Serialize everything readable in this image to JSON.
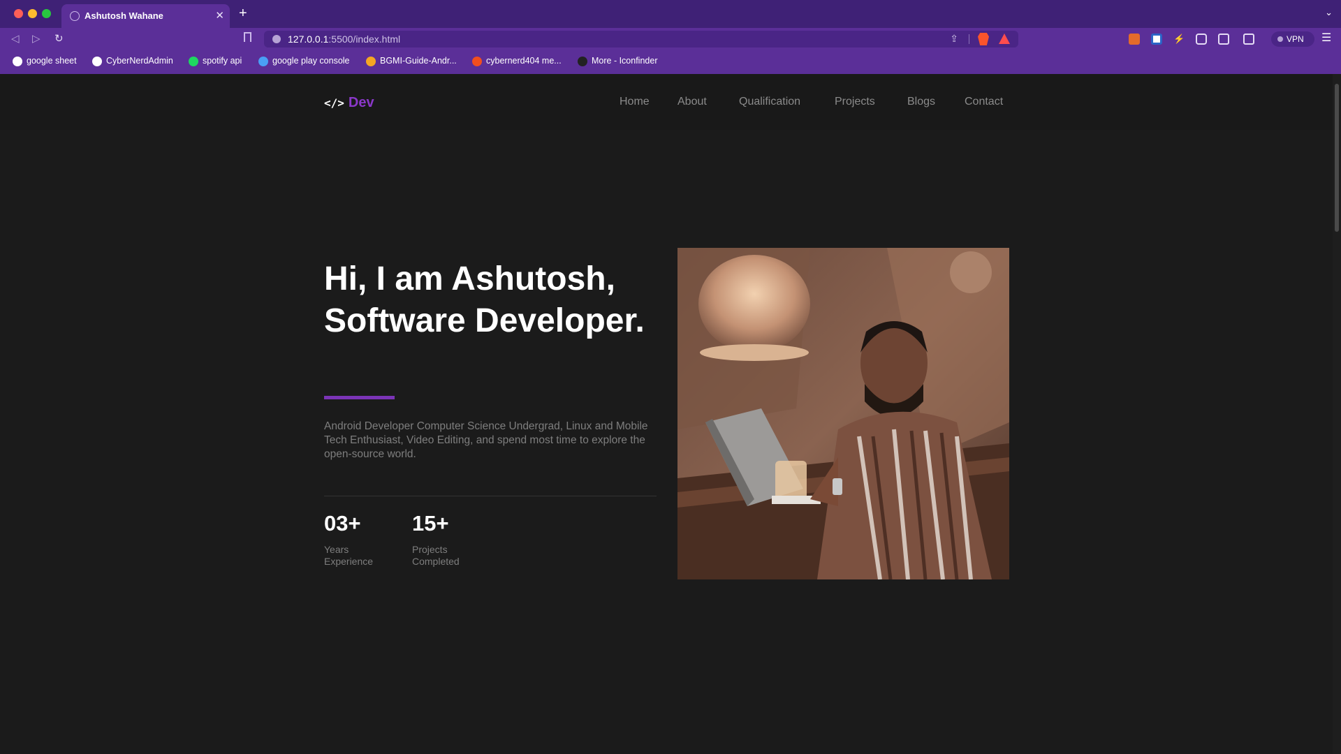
{
  "browser": {
    "tab_title": "Ashutosh Wahane",
    "tab_close": "✕",
    "new_tab": "+",
    "tabs_menu": "⌄",
    "url_host": "127.0.0.1",
    "url_path": ":5500/index.html",
    "vpn_label": "VPN",
    "menu_icon": "☰",
    "back_icon": "◁",
    "forward_icon": "▷",
    "reload_icon": "↻",
    "share_icon": "⇪",
    "bookmarks": [
      {
        "label": "google sheet",
        "icon_color": "#ffffff"
      },
      {
        "label": "CyberNerdAdmin",
        "icon_color": "#ffffff"
      },
      {
        "label": "spotify api",
        "icon_color": "#1ed760"
      },
      {
        "label": "google play console",
        "icon_color": "#4a9ff5"
      },
      {
        "label": "BGMI-Guide-Andr...",
        "icon_color": "#f5a623"
      },
      {
        "label": "cybernerd404 me...",
        "icon_color": "#f24e1e"
      },
      {
        "label": "More - Iconfinder",
        "icon_color": "#222222"
      }
    ]
  },
  "site": {
    "logo_code": "</>",
    "logo_text": "Dev",
    "nav": [
      "Home",
      "About",
      "Qualification",
      "Projects",
      "Blogs",
      "Contact"
    ],
    "hero": {
      "title": "Hi, I am Ashutosh, Software Developer.",
      "description": "Android Developer Computer Science Undergrad, Linux and Mobile Tech Enthusiast, Video Editing, and spend most time to explore the open-source world."
    },
    "stats": [
      {
        "value": "03+",
        "label_line1": "Years",
        "label_line2": "Experience"
      },
      {
        "value": "15+",
        "label_line1": "Projects",
        "label_line2": "Completed"
      }
    ]
  },
  "colors": {
    "accent": "#7b34b7",
    "page_bg": "#1b1b1b",
    "chrome_bg": "#5b2f98"
  }
}
